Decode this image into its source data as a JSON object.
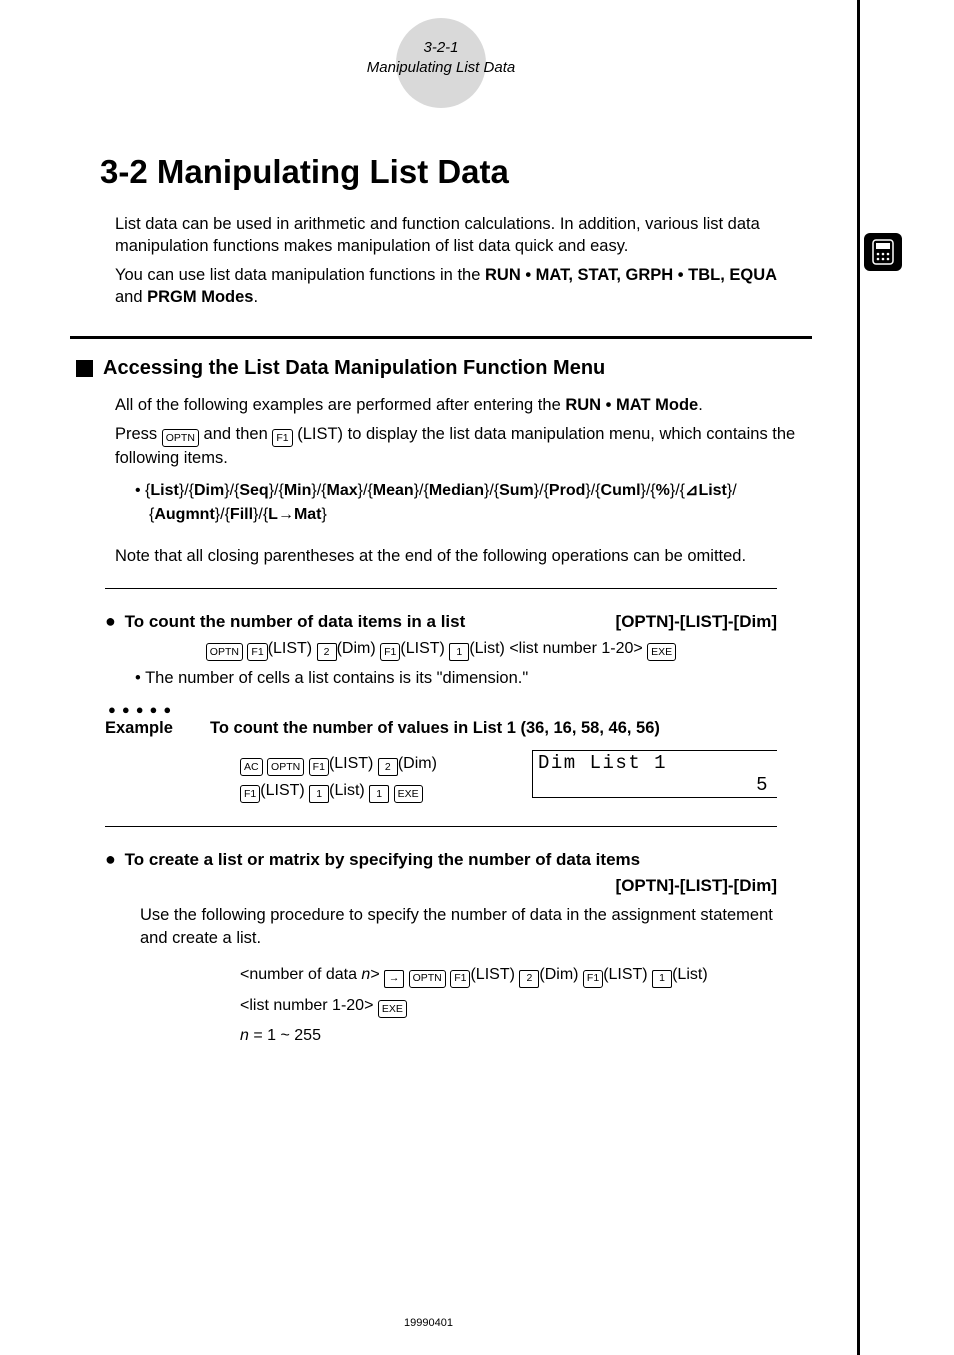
{
  "header": {
    "page_ref": "3-2-1",
    "page_subtitle": "Manipulating List Data"
  },
  "title": "3-2  Manipulating List Data",
  "intro": {
    "p1": "List data can be used in arithmetic and function calculations. In addition, various list data manipulation functions makes manipulation of list data quick and easy.",
    "p2_pre": "You can use list data manipulation functions in the ",
    "modes": "RUN • MAT, STAT, GRPH • TBL, EQUA",
    "p2_mid": " and ",
    "modes2": "PRGM Modes",
    "p2_post": "."
  },
  "section1": {
    "heading": "Accessing the List Data Manipulation Function Menu",
    "p1_pre": "All of the following examples are performed after entering the ",
    "p1_mode": "RUN • MAT Mode",
    "p1_post": ".",
    "p2_pre": "Press ",
    "k_optn": "OPTN",
    "p2_mid": " and then ",
    "k_f1": "F1",
    "p2_label": "(LIST) to display the list data manipulation menu, which contains the following items.",
    "menu": "• {List}/{Dim}/{Seq}/{Min}/{Max}/{Mean}/{Median}/{Sum}/{Prod}/{Cuml}/{%}/{⊿List}/{Augmnt}/{Fill}/{L→Mat}",
    "note": "Note that all closing parentheses at the end of the following operations can be omitted."
  },
  "op1": {
    "title": "To count the number of data items in a list",
    "path": "[OPTN]-[LIST]-[Dim]",
    "keyline_parts": {
      "k_optn": "OPTN",
      "k_f1a": "F1",
      "t1": "(LIST)",
      "k_2": "2",
      "t2": "(Dim)",
      "k_f1b": "F1",
      "t3": "(LIST)",
      "k_1": "1",
      "t4": "(List) <list number 1-20>",
      "k_exe": "EXE"
    },
    "sub": "• The number of cells a list contains is its \"dimension.\"",
    "example_label": "Example",
    "example_text": "To count the number of values in List 1 (36, 16, 58, 46, 56)",
    "ex_keys": {
      "k_ac": "AC",
      "k_optn": "OPTN",
      "k_f1a": "F1",
      "t1": "(LIST)",
      "k_2": "2",
      "t2": "(Dim)",
      "k_f1b": "F1",
      "t3": "(LIST)",
      "k_1a": "1",
      "t4": "(List)",
      "k_1b": "1",
      "k_exe": "EXE"
    },
    "display_l1": "Dim List 1",
    "display_l2": "5"
  },
  "op2": {
    "title": "To create a list or matrix by specifying the number of data items",
    "path": "[OPTN]-[LIST]-[Dim]",
    "desc": "Use the following procedure to specify the number of data in the assignment statement and create a list.",
    "keys": {
      "pre": "<number of data ",
      "n": "n",
      "post": ">",
      "k_arrow": "→",
      "k_optn": "OPTN",
      "k_f1a": "F1",
      "t1": "(LIST)",
      "k_2": "2",
      "t2": "(Dim)",
      "k_f1b": "F1",
      "t3": "(LIST)",
      "k_1": "1",
      "t4": "(List)",
      "line2": "<list number 1-20>",
      "k_exe": "EXE"
    },
    "range_n": "n",
    "range": " = 1 ~ 255"
  },
  "footer": "19990401"
}
